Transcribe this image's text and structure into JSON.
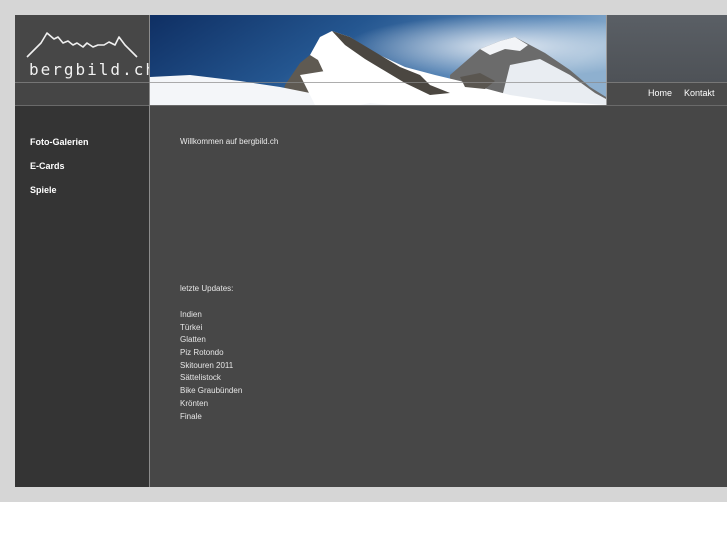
{
  "site": {
    "logo_text": "bergbild.ch"
  },
  "header": {
    "nav": [
      {
        "label": "Home"
      },
      {
        "label": "Kontakt"
      }
    ]
  },
  "sidebar": {
    "items": [
      {
        "label": "Foto-Galerien"
      },
      {
        "label": "E-Cards"
      },
      {
        "label": "Spiele"
      }
    ]
  },
  "main": {
    "welcome": "Willkommen auf bergbild.ch",
    "updates_title": "letzte Updates:",
    "updates": [
      "Indien",
      "Türkei",
      "Glatten",
      "Piz Rotondo",
      "Skitouren 2011",
      "Sättelistock",
      "Bike Graubünden",
      "Krönten",
      "Finale"
    ]
  },
  "colors": {
    "page_bg": "#d6d6d6",
    "content_bg": "#474747",
    "sidebar_bg": "#343434",
    "text": "#ffffff"
  }
}
